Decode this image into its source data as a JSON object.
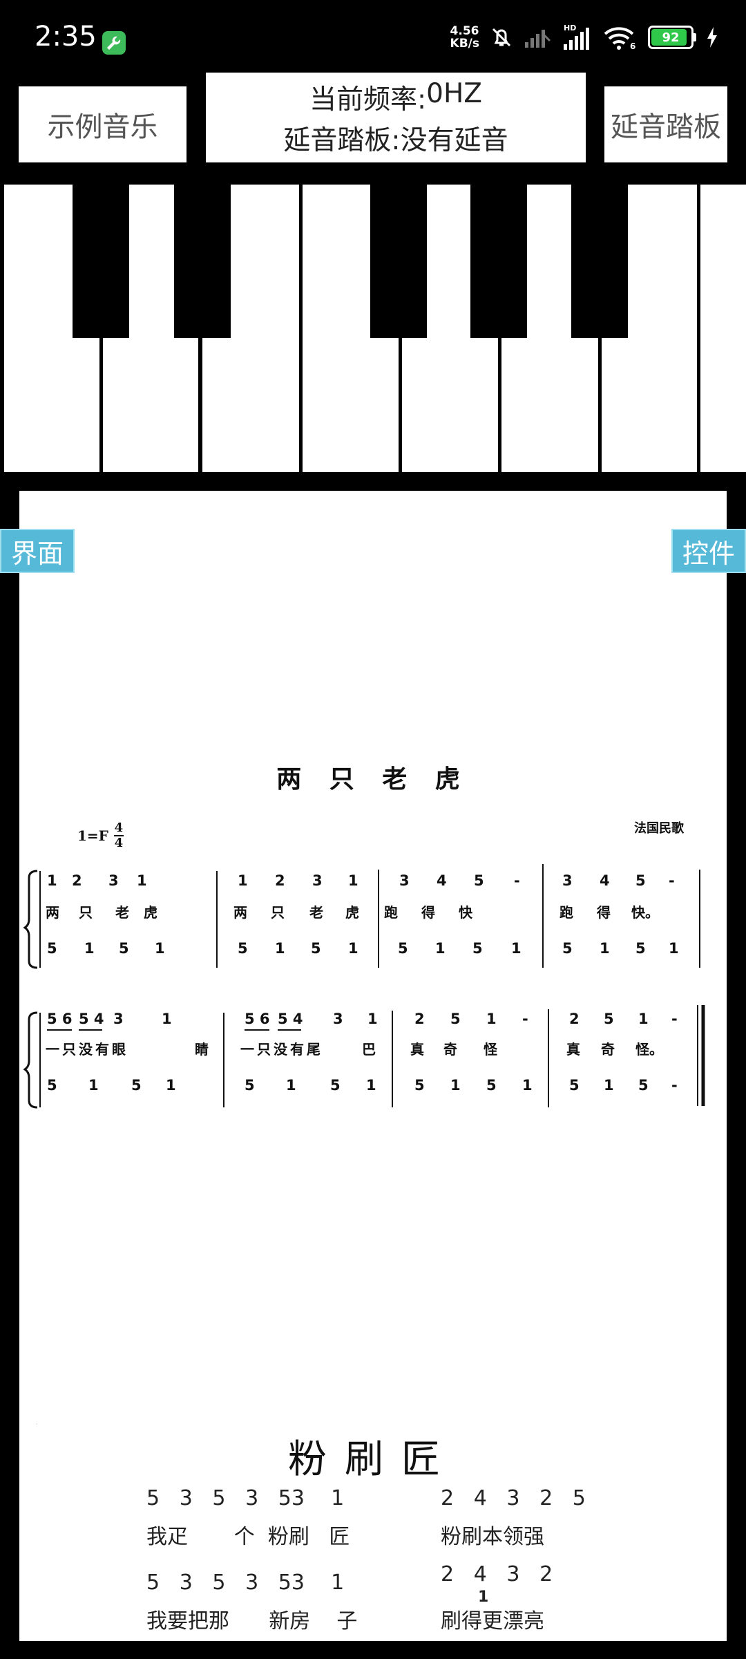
{
  "status_bar": {
    "time": "2:35",
    "net_speed_value": "4.56",
    "net_speed_unit": "KB/s",
    "signal_hd": "HD",
    "wifi_label": "6",
    "battery": "92",
    "battery_level": 0.92
  },
  "toolbar": {
    "example_music_label": "示例音乐",
    "sustain_pedal_label": "延音踏板"
  },
  "info": {
    "frequency_label": "当前频率:",
    "frequency_value": "0HZ",
    "pedal_label": "延音踏板:",
    "pedal_value": "没有延音"
  },
  "side_tabs": {
    "left": "界面",
    "right": "控件"
  },
  "score1": {
    "title": "两 只 老 虎",
    "key": "1=F",
    "time_top": "4",
    "time_bottom": "4",
    "origin": "法国民歌",
    "system1": {
      "melody": [
        "1",
        "2",
        "3",
        "1",
        "1",
        "2",
        "3",
        "1",
        "3",
        "4",
        "5",
        "-",
        "3",
        "4",
        "5",
        "-"
      ],
      "lyrics": [
        "两",
        "只",
        "老",
        "虎",
        "两",
        "只",
        "老",
        "虎",
        "跑",
        "得",
        "快",
        "跑",
        "得",
        "快。"
      ],
      "bass": [
        "5",
        "1",
        "5",
        "1",
        "5",
        "1",
        "5",
        "1",
        "5",
        "1",
        "5",
        "1",
        "5",
        "1",
        "5",
        "1"
      ]
    },
    "system2": {
      "melody": [
        "5 6",
        "5 4",
        "3",
        "1",
        "5 6",
        "5 4",
        "3",
        "1",
        "2",
        "5",
        "1",
        "-",
        "2",
        "5",
        "1",
        "-"
      ],
      "lyrics": [
        "一只没有眼",
        "睛",
        "一只没有尾",
        "巴",
        "真",
        "奇",
        "怪",
        "真",
        "奇",
        "怪。"
      ],
      "bass": [
        "5",
        "1",
        "5",
        "1",
        "5",
        "1",
        "5",
        "1",
        "5",
        "1",
        "5",
        "1",
        "5",
        "1",
        "5",
        "-"
      ]
    }
  },
  "score2": {
    "title": "粉刷匠",
    "line1_notes_left": "5   3   5   3   53    1",
    "line1_notes_right": "2   4   3   2   5",
    "line1_lyrics_left": "我疋       个  粉刷   匠",
    "line1_lyrics_right": "粉刷本领强",
    "line2_notes_left": "5   3   5   3   53    1",
    "line2_notes_right": "2   4   3   2",
    "line2_extra_note": "1",
    "line2_lyrics_left": "我要把那      新房    子",
    "line2_lyrics_right": "刷得更漂亮"
  },
  "colors": {
    "tab_blue": "#56b9d8",
    "button_text": "#555555",
    "battery_green": "#2fc84a"
  }
}
